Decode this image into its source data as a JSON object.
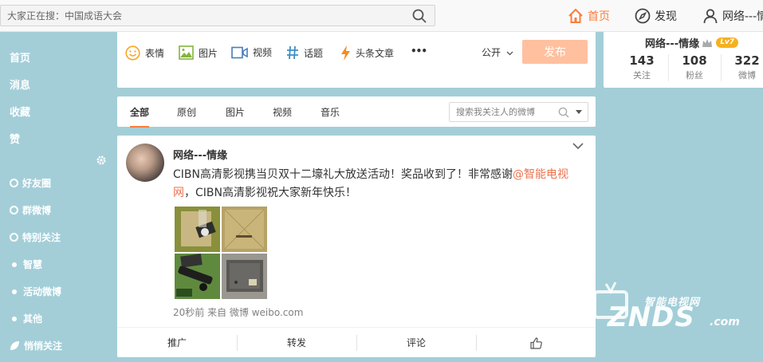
{
  "search": {
    "placeholder": "大家正在搜：中国成语大会"
  },
  "topnav": {
    "home": "首页",
    "discover": "发现",
    "user": "网络---情"
  },
  "sidebar": {
    "main": [
      "首页",
      "消息",
      "收藏",
      "赞"
    ],
    "groups": [
      {
        "label": "好友圈",
        "icon": "heart-circle-icon"
      },
      {
        "label": "群微博",
        "icon": "group-icon"
      },
      {
        "label": "特别关注",
        "icon": "eye-icon"
      },
      {
        "label": "智慧",
        "icon": "dot-icon"
      },
      {
        "label": "活动微博",
        "icon": "dot-icon"
      },
      {
        "label": "其他",
        "icon": "dot-icon"
      },
      {
        "label": "悄悄关注",
        "icon": "leaf-icon"
      }
    ]
  },
  "composer": {
    "tools": [
      "表情",
      "图片",
      "视频",
      "话题",
      "头条文章"
    ],
    "more": "•••",
    "privacy": "公开",
    "publish": "发布"
  },
  "feed_tabs": {
    "items": [
      "全部",
      "原创",
      "图片",
      "视频",
      "音乐"
    ],
    "search_placeholder": "搜索我关注人的微博"
  },
  "post": {
    "author": "网络---情缘",
    "text_before": "CIBN高清影视携当贝双十二壕礼大放送活动！奖品收到了！非常感谢",
    "mention": "@智能电视网",
    "text_after": "，CIBN高清影视祝大家新年快乐！",
    "meta": "20秒前 来自 微博 weibo.com",
    "actions": [
      "推广",
      "转发",
      "评论",
      ""
    ]
  },
  "profile": {
    "name": "网络---情缘",
    "level": "Lv7",
    "stats": [
      {
        "num": "143",
        "label": "关注"
      },
      {
        "num": "108",
        "label": "粉丝"
      },
      {
        "num": "322",
        "label": "微博"
      }
    ]
  },
  "watermark": {
    "top": "智能电视网",
    "main": "ZNDS",
    "suffix": ".com"
  },
  "colors": {
    "accent": "#fa7d3c",
    "mention": "#eb7350",
    "bg": "#a3ced8",
    "publish": "#ffc09f"
  }
}
